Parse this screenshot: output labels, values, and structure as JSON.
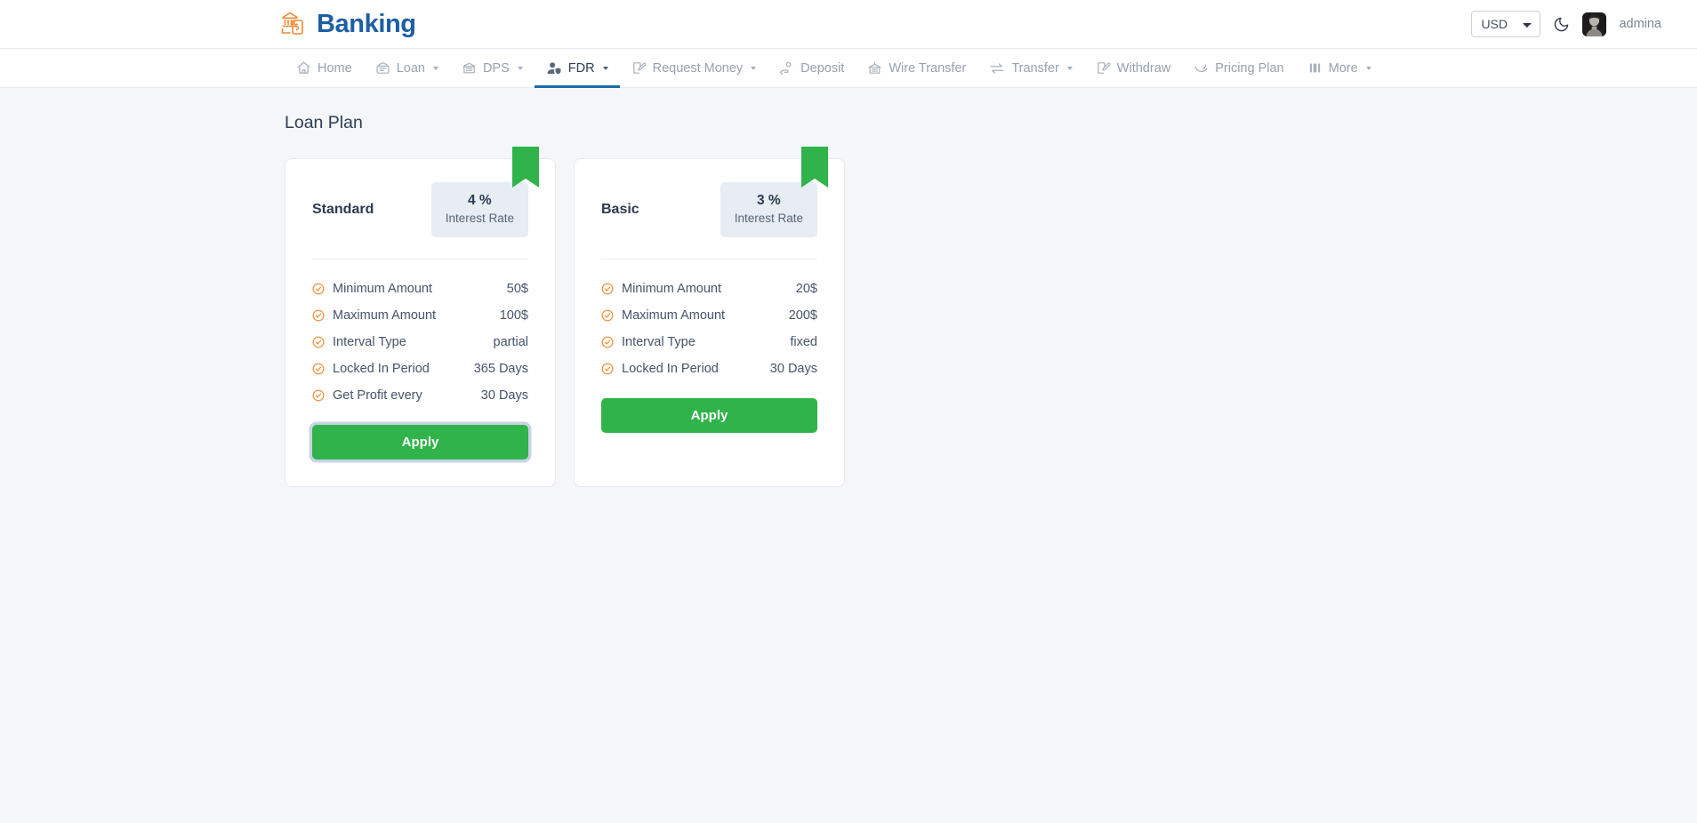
{
  "header": {
    "brand": "Banking",
    "brand_icon": "bank-mobile-icon",
    "currency": {
      "selected": "USD",
      "options": [
        "USD"
      ]
    },
    "theme_toggle_icon": "moon-icon",
    "avatar_icon": "user-avatar",
    "username": "admina"
  },
  "nav": {
    "items": [
      {
        "label": "Home",
        "icon": "home-icon",
        "caret": false,
        "active": false
      },
      {
        "label": "Loan",
        "icon": "loan-icon",
        "caret": true,
        "active": false
      },
      {
        "label": "DPS",
        "icon": "bank-icon",
        "caret": true,
        "active": false
      },
      {
        "label": "FDR",
        "icon": "user-shield-icon",
        "caret": true,
        "active": true
      },
      {
        "label": "Request Money",
        "icon": "request-money-icon",
        "caret": true,
        "active": false
      },
      {
        "label": "Deposit",
        "icon": "hand-coin-icon",
        "caret": false,
        "active": false
      },
      {
        "label": "Wire Transfer",
        "icon": "wire-transfer-icon",
        "caret": false,
        "active": false
      },
      {
        "label": "Transfer",
        "icon": "exchange-arrows-icon",
        "caret": true,
        "active": false
      },
      {
        "label": "Withdraw",
        "icon": "withdraw-icon",
        "caret": false,
        "active": false
      },
      {
        "label": "Pricing Plan",
        "icon": "pricing-plan-icon",
        "caret": false,
        "active": false
      },
      {
        "label": "More",
        "icon": "more-icon",
        "caret": true,
        "active": false
      }
    ]
  },
  "main": {
    "title": "Loan Plan",
    "cards": [
      {
        "name": "Standard",
        "rate_value": "4 %",
        "rate_label": "Interest Rate",
        "features": [
          {
            "label": "Minimum Amount",
            "value": "50$"
          },
          {
            "label": "Maximum Amount",
            "value": "100$"
          },
          {
            "label": "Interval Type",
            "value": "partial"
          },
          {
            "label": "Locked In Period",
            "value": "365 Days"
          },
          {
            "label": "Get Profit every",
            "value": "30 Days"
          }
        ],
        "apply_label": "Apply",
        "focused": true
      },
      {
        "name": "Basic",
        "rate_value": "3 %",
        "rate_label": "Interest Rate",
        "features": [
          {
            "label": "Minimum Amount",
            "value": "20$"
          },
          {
            "label": "Maximum Amount",
            "value": "200$"
          },
          {
            "label": "Interval Type",
            "value": "fixed"
          },
          {
            "label": "Locked In Period",
            "value": "30 Days"
          }
        ],
        "apply_label": "Apply",
        "focused": false
      }
    ]
  },
  "colors": {
    "brand_blue": "#1d5fa4",
    "accent_orange": "#f08a34",
    "green": "#2fb34a",
    "active_underline": "#1a6aa8",
    "badge_bg": "#e7edf2",
    "page_bg": "#f4f6f9"
  }
}
